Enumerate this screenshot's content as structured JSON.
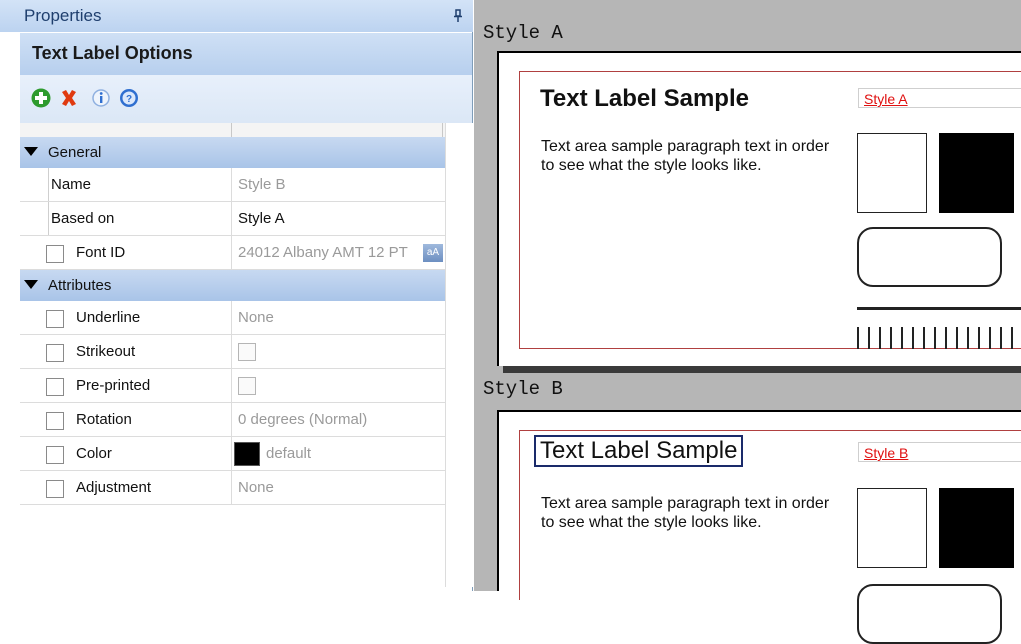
{
  "panel": {
    "title": "Properties",
    "pin_icon": "pin-icon",
    "section_title": "Text Label Options",
    "toolbar": [
      {
        "icon": "add-icon",
        "color": "#2e9b2e"
      },
      {
        "icon": "delete-icon",
        "color": "#e03a10"
      },
      {
        "icon": "info-icon",
        "color": "#2f6fd0"
      },
      {
        "icon": "help-icon",
        "color": "#2f6fd0"
      }
    ]
  },
  "categories": {
    "general": "General",
    "attributes": "Attributes"
  },
  "general_rows": {
    "name": {
      "label": "Name",
      "value": "Style B"
    },
    "based_on": {
      "label": "Based on",
      "value": "Style A"
    },
    "font_id": {
      "label": "Font ID",
      "value": "24012 Albany AMT 12 PT",
      "button": "aA"
    }
  },
  "attribute_rows": {
    "underline": {
      "label": "Underline",
      "value": "None"
    },
    "strikeout": {
      "label": "Strikeout",
      "checked": false
    },
    "preprinted": {
      "label": "Pre-printed",
      "checked": false
    },
    "rotation": {
      "label": "Rotation",
      "value": "0 degrees (Normal)"
    },
    "color": {
      "label": "Color",
      "value": "default",
      "swatch": "#000000"
    },
    "adjustment": {
      "label": "Adjustment",
      "value": "None"
    }
  },
  "preview": {
    "style_a": {
      "heading": "Style A",
      "sample_title": "Text Label Sample",
      "paragraph": "Text area sample paragraph text in order to see what the style looks like.",
      "tag": "Style A"
    },
    "style_b": {
      "heading": "Style B",
      "sample_title": "Text Label Sample",
      "paragraph": "Text area sample paragraph text in order to see what the style looks like.",
      "tag": "Style B"
    }
  }
}
